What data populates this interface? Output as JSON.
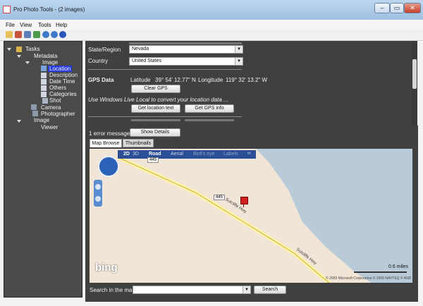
{
  "window": {
    "title": "Pro Photo Tools - (2 images)",
    "minimize": "–",
    "maximize": "▭",
    "close": "✕"
  },
  "menu": [
    "File",
    "View",
    "Tools",
    "Help"
  ],
  "tree": {
    "tasks": "Tasks",
    "metadata": "Metadata",
    "image": "Image",
    "location": "Location",
    "description": "Description",
    "date_time": "Date Time",
    "others": "Others",
    "categories": "Categories",
    "shot": "Shot",
    "camera": "Camera",
    "photographer": "Photographer",
    "image2": "Image",
    "viewer": "Viewer"
  },
  "form": {
    "state_label": "State/Region",
    "state_value": "Nevada",
    "country_label": "Country",
    "country_value": "United States",
    "gps_label": "GPS Data",
    "lat_label": "Latitude",
    "lat_value": "39° 54' 12.77\" N",
    "lon_label": "Longitude",
    "lon_value": "119° 32' 13.2\" W",
    "clear_gps": "Clear GPS",
    "hint": "Use Windows Live Local to convert your location data ...",
    "get_location_text": "Get location text",
    "get_gps_info": "Get GPS info"
  },
  "errors": {
    "message": "1 error message.",
    "show_details": "Show Details"
  },
  "tabs": [
    "Map Browse",
    "Thumbnails"
  ],
  "map": {
    "modes": [
      "2D",
      "3D",
      "Road",
      "Aerial",
      "Bird's eye",
      "Labels",
      "‹‹"
    ],
    "route_shield": "445",
    "road_label": "Sutcliffe Hwy",
    "scale": "0.6 miles",
    "logo": "bing",
    "copyright": "© 2009 Microsoft Corporation   © 2009 NAVTEQ   © AND"
  },
  "search": {
    "label": "Search in the map",
    "button": "Search"
  },
  "colors": {
    "land": "#f0e5d6",
    "water": "#b9cbd8",
    "panel": "#404040",
    "tree_bg": "#4a4a4a",
    "selection": "#2a3dd8"
  }
}
